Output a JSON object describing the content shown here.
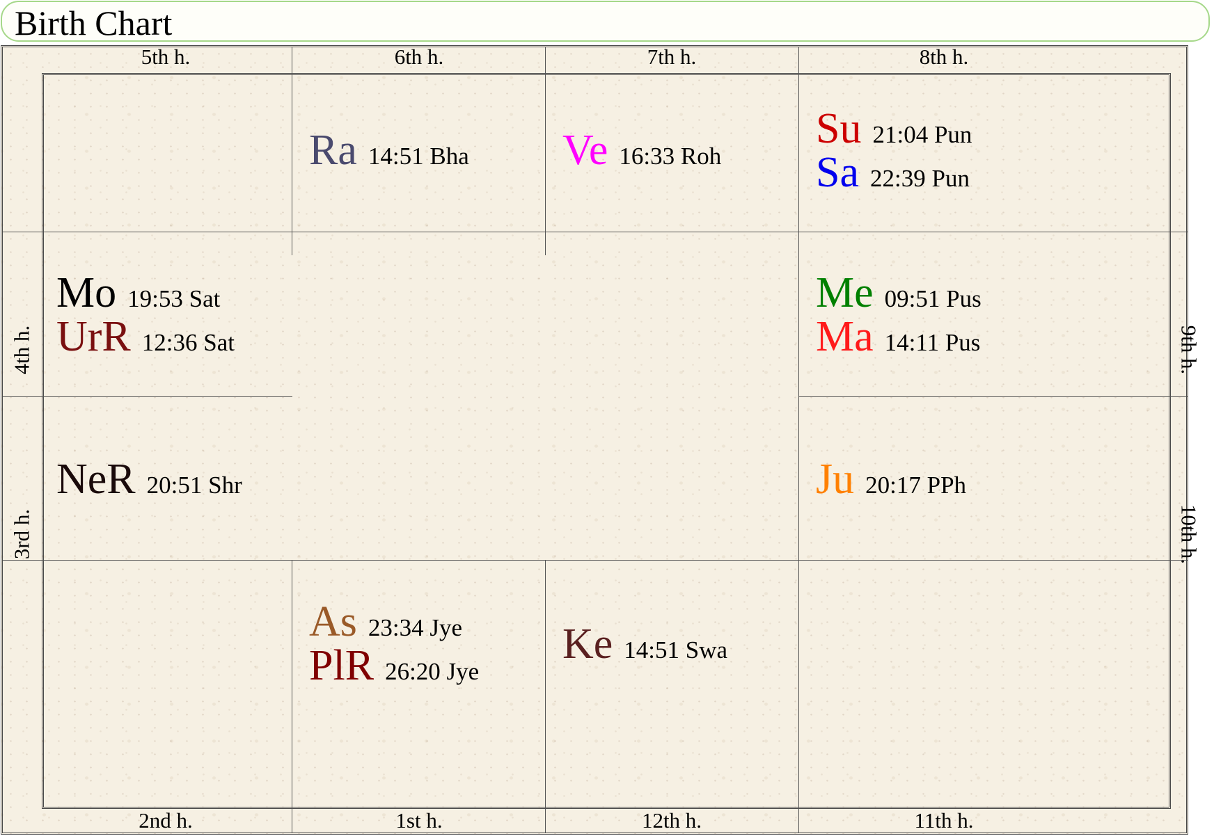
{
  "title": "Birth Chart",
  "houses": {
    "h5": "5th h.",
    "h6": "6th h.",
    "h7": "7th h.",
    "h8": "8th h.",
    "h4": "4th h.",
    "h9": "9th h.",
    "h3": "3rd h.",
    "h10": "10th h.",
    "h2": "2nd h.",
    "h1": "1st h.",
    "h12": "12th h.",
    "h11": "11th h."
  },
  "planets": {
    "ra": {
      "abbr": "Ra",
      "info": "14:51 Bha",
      "color": "#4a4a6e"
    },
    "ve": {
      "abbr": "Ve",
      "info": "16:33 Roh",
      "color": "#ff00ff"
    },
    "su": {
      "abbr": "Su",
      "info": "21:04 Pun",
      "color": "#cc0000"
    },
    "sa": {
      "abbr": "Sa",
      "info": "22:39 Pun",
      "color": "#0000ee"
    },
    "mo": {
      "abbr": "Mo",
      "info": "19:53 Sat",
      "color": "#000000"
    },
    "ur": {
      "abbr": "UrR",
      "info": "12:36 Sat",
      "color": "#7a1010"
    },
    "me": {
      "abbr": "Me",
      "info": "09:51 Pus",
      "color": "#008000"
    },
    "ma": {
      "abbr": "Ma",
      "info": "14:11 Pus",
      "color": "#ff1a1a"
    },
    "ne": {
      "abbr": "NeR",
      "info": "20:51 Shr",
      "color": "#1a0a0a"
    },
    "ju": {
      "abbr": "Ju",
      "info": "20:17 PPh",
      "color": "#ff8000"
    },
    "as": {
      "abbr": "As",
      "info": "23:34 Jye",
      "color": "#9a5a28"
    },
    "pl": {
      "abbr": "PlR",
      "info": "26:20 Jye",
      "color": "#800000"
    },
    "ke": {
      "abbr": "Ke",
      "info": "14:51 Swa",
      "color": "#5a2020"
    }
  }
}
